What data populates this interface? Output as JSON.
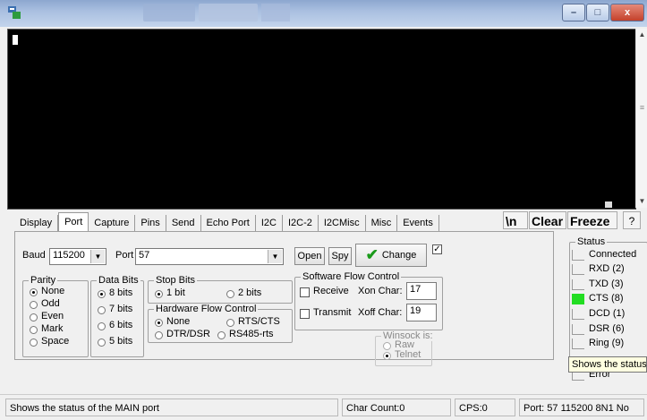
{
  "window": {
    "app_icon": "terminal-app-icon",
    "controls": {
      "minimize": "–",
      "maximize": "□",
      "close": "x"
    }
  },
  "tabs": [
    "Display",
    "Port",
    "Capture",
    "Pins",
    "Send",
    "Echo Port",
    "I2C",
    "I2C-2",
    "I2CMisc",
    "Misc",
    "Events"
  ],
  "active_tab": "Port",
  "toolbar": {
    "newline": "\\n",
    "clear": "Clear",
    "freeze": "Freeze",
    "help": "?"
  },
  "port": {
    "baud_label": "Baud",
    "baud_value": "115200",
    "port_label": "Port",
    "port_value": "57",
    "open": "Open",
    "spy": "Spy",
    "change": "Change",
    "change_checked": true
  },
  "parity": {
    "title": "Parity",
    "options": [
      "None",
      "Odd",
      "Even",
      "Mark",
      "Space"
    ],
    "selected": "None"
  },
  "data_bits": {
    "title": "Data Bits",
    "options": [
      "8 bits",
      "7 bits",
      "6 bits",
      "5 bits"
    ],
    "selected": "8 bits"
  },
  "stop_bits": {
    "title": "Stop Bits",
    "options": [
      "1 bit",
      "2 bits"
    ],
    "selected": "1 bit"
  },
  "hw_flow": {
    "title": "Hardware Flow Control",
    "options": [
      "None",
      "RTS/CTS",
      "DTR/DSR",
      "RS485-rts"
    ],
    "selected": "None"
  },
  "sw_flow": {
    "title": "Software Flow Control",
    "receive": "Receive",
    "xon_label": "Xon Char:",
    "xon_value": "17",
    "transmit": "Transmit",
    "xoff_label": "Xoff Char:",
    "xoff_value": "19"
  },
  "winsock": {
    "title": "Winsock is:",
    "options": [
      "Raw",
      "Telnet"
    ],
    "selected": "Telnet"
  },
  "status": {
    "title": "Status",
    "items": [
      "Connected",
      "RXD (2)",
      "TXD (3)",
      "CTS (8)",
      "DCD (1)",
      "DSR (6)",
      "Ring (9)",
      "Error"
    ],
    "active": "CTS (8)",
    "on_color": "#22dd22"
  },
  "tooltip": "Shows the status of the MAIN port",
  "statusbar": {
    "message": "Shows the status of the MAIN port",
    "char_count": "Char Count:0",
    "cps": "CPS:0",
    "port_info": "Port: 57 115200 8N1 No"
  }
}
